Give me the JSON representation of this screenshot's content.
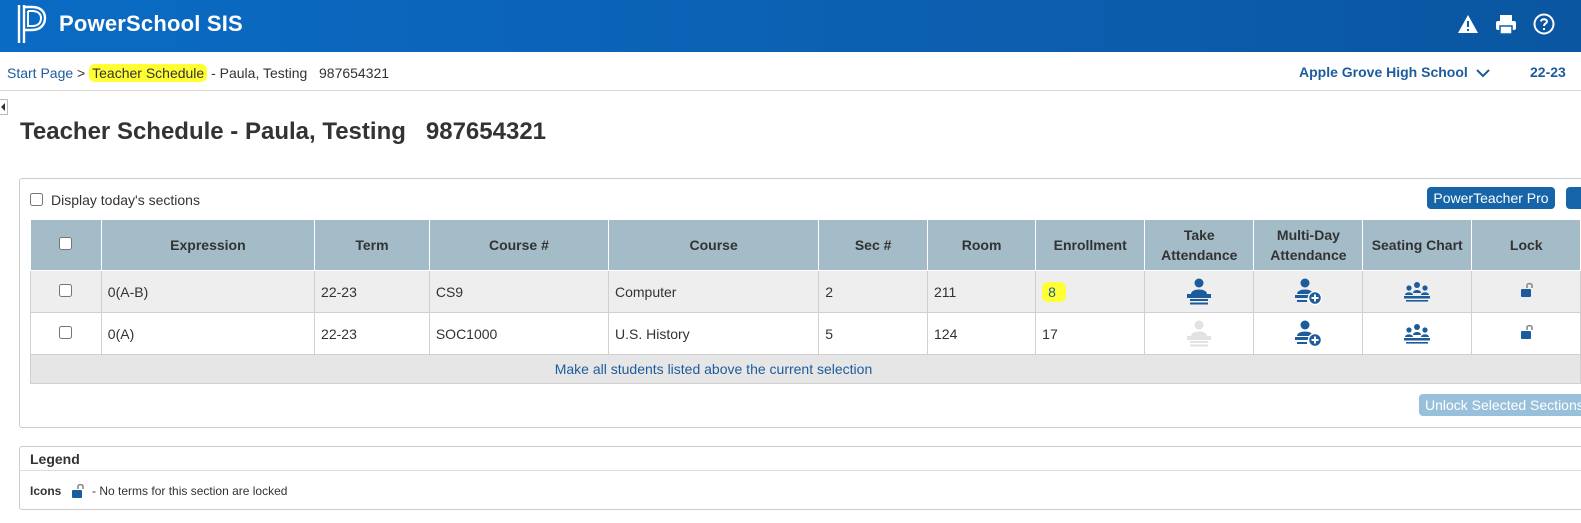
{
  "header": {
    "app_title": "PowerSchool SIS"
  },
  "breadcrumb": {
    "start_page": "Start Page",
    "separator": ">",
    "current": "Teacher Schedule",
    "suffix": "- Paula, Testing   987654321"
  },
  "school_selector": {
    "school": "Apple Grove High School",
    "term": "22-23"
  },
  "page_title": "Teacher Schedule - Paula, Testing   987654321",
  "display_today_label": "Display today's sections",
  "powerteacher_button": "PowerTeacher Pro",
  "table": {
    "headers": {
      "expression": "Expression",
      "term": "Term",
      "course_num": "Course #",
      "course": "Course",
      "sec_num": "Sec #",
      "room": "Room",
      "enrollment": "Enrollment",
      "take_attendance_1": "Take",
      "take_attendance_2": "Attendance",
      "multiday_1": "Multi-Day",
      "multiday_2": "Attendance",
      "seating_chart": "Seating Chart",
      "lock": "Lock"
    },
    "rows": [
      {
        "expression": "0(A-B)",
        "term": "22-23",
        "course_num": "CS9",
        "course": "Computer",
        "sec_num": "2",
        "room": "211",
        "enrollment": "8"
      },
      {
        "expression": "0(A)",
        "term": "22-23",
        "course_num": "SOC1000",
        "course": "U.S. History",
        "sec_num": "5",
        "room": "124",
        "enrollment": "17"
      }
    ],
    "footer_link": "Make all students listed above the current selection"
  },
  "unlock_button": "Unlock Selected Sections",
  "legend": {
    "title": "Legend",
    "icons_label": "Icons",
    "lock_text": "- No terms for this section are locked"
  },
  "colors": {
    "header_blue": "#0a6bc4",
    "link_blue": "#1d5c9c",
    "table_header": "#a3bcc8",
    "highlight": "#ffff33",
    "button_blue": "#1565a8"
  },
  "icons": [
    "powerschool-logo-icon",
    "alert-icon",
    "print-icon",
    "help-icon",
    "chevron-down-icon",
    "take-attendance-icon",
    "multiday-attendance-icon",
    "seating-chart-icon",
    "unlocked-icon"
  ]
}
